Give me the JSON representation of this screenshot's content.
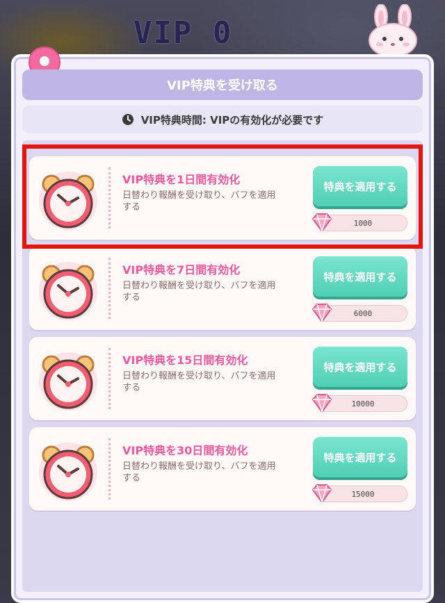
{
  "header": {
    "vip_level": "VIP 0"
  },
  "panel": {
    "title": "VIP特典を受け取る",
    "timer_text": "VIP特典時間:  VIPの有効化が必要です"
  },
  "offers": [
    {
      "title": "VIP特典を1日間有効化",
      "desc": "日替わり報酬を受け取り、バフを適用する",
      "button": "特典を適用する",
      "cost": "1000"
    },
    {
      "title": "VIP特典を7日間有効化",
      "desc": "日替わり報酬を受け取り、バフを適用する",
      "button": "特典を適用する",
      "cost": "6000"
    },
    {
      "title": "VIP特典を15日間有効化",
      "desc": "日替わり報酬を受け取り、バフを適用する",
      "button": "特典を適用する",
      "cost": "10000"
    },
    {
      "title": "VIP特典を30日間有効化",
      "desc": "日替わり報酬を受け取り、バフを適用する",
      "button": "特典を適用する",
      "cost": "15000"
    }
  ],
  "colors": {
    "accent_pink": "#f0569b",
    "button_teal": "#4fcfb4",
    "highlight_red": "#e4140f",
    "title_bar": "#bfb6e6"
  },
  "icons": [
    "bunny-icon",
    "map-pin-icon",
    "clock-icon",
    "alarm-clock-icon",
    "gem-icon"
  ]
}
